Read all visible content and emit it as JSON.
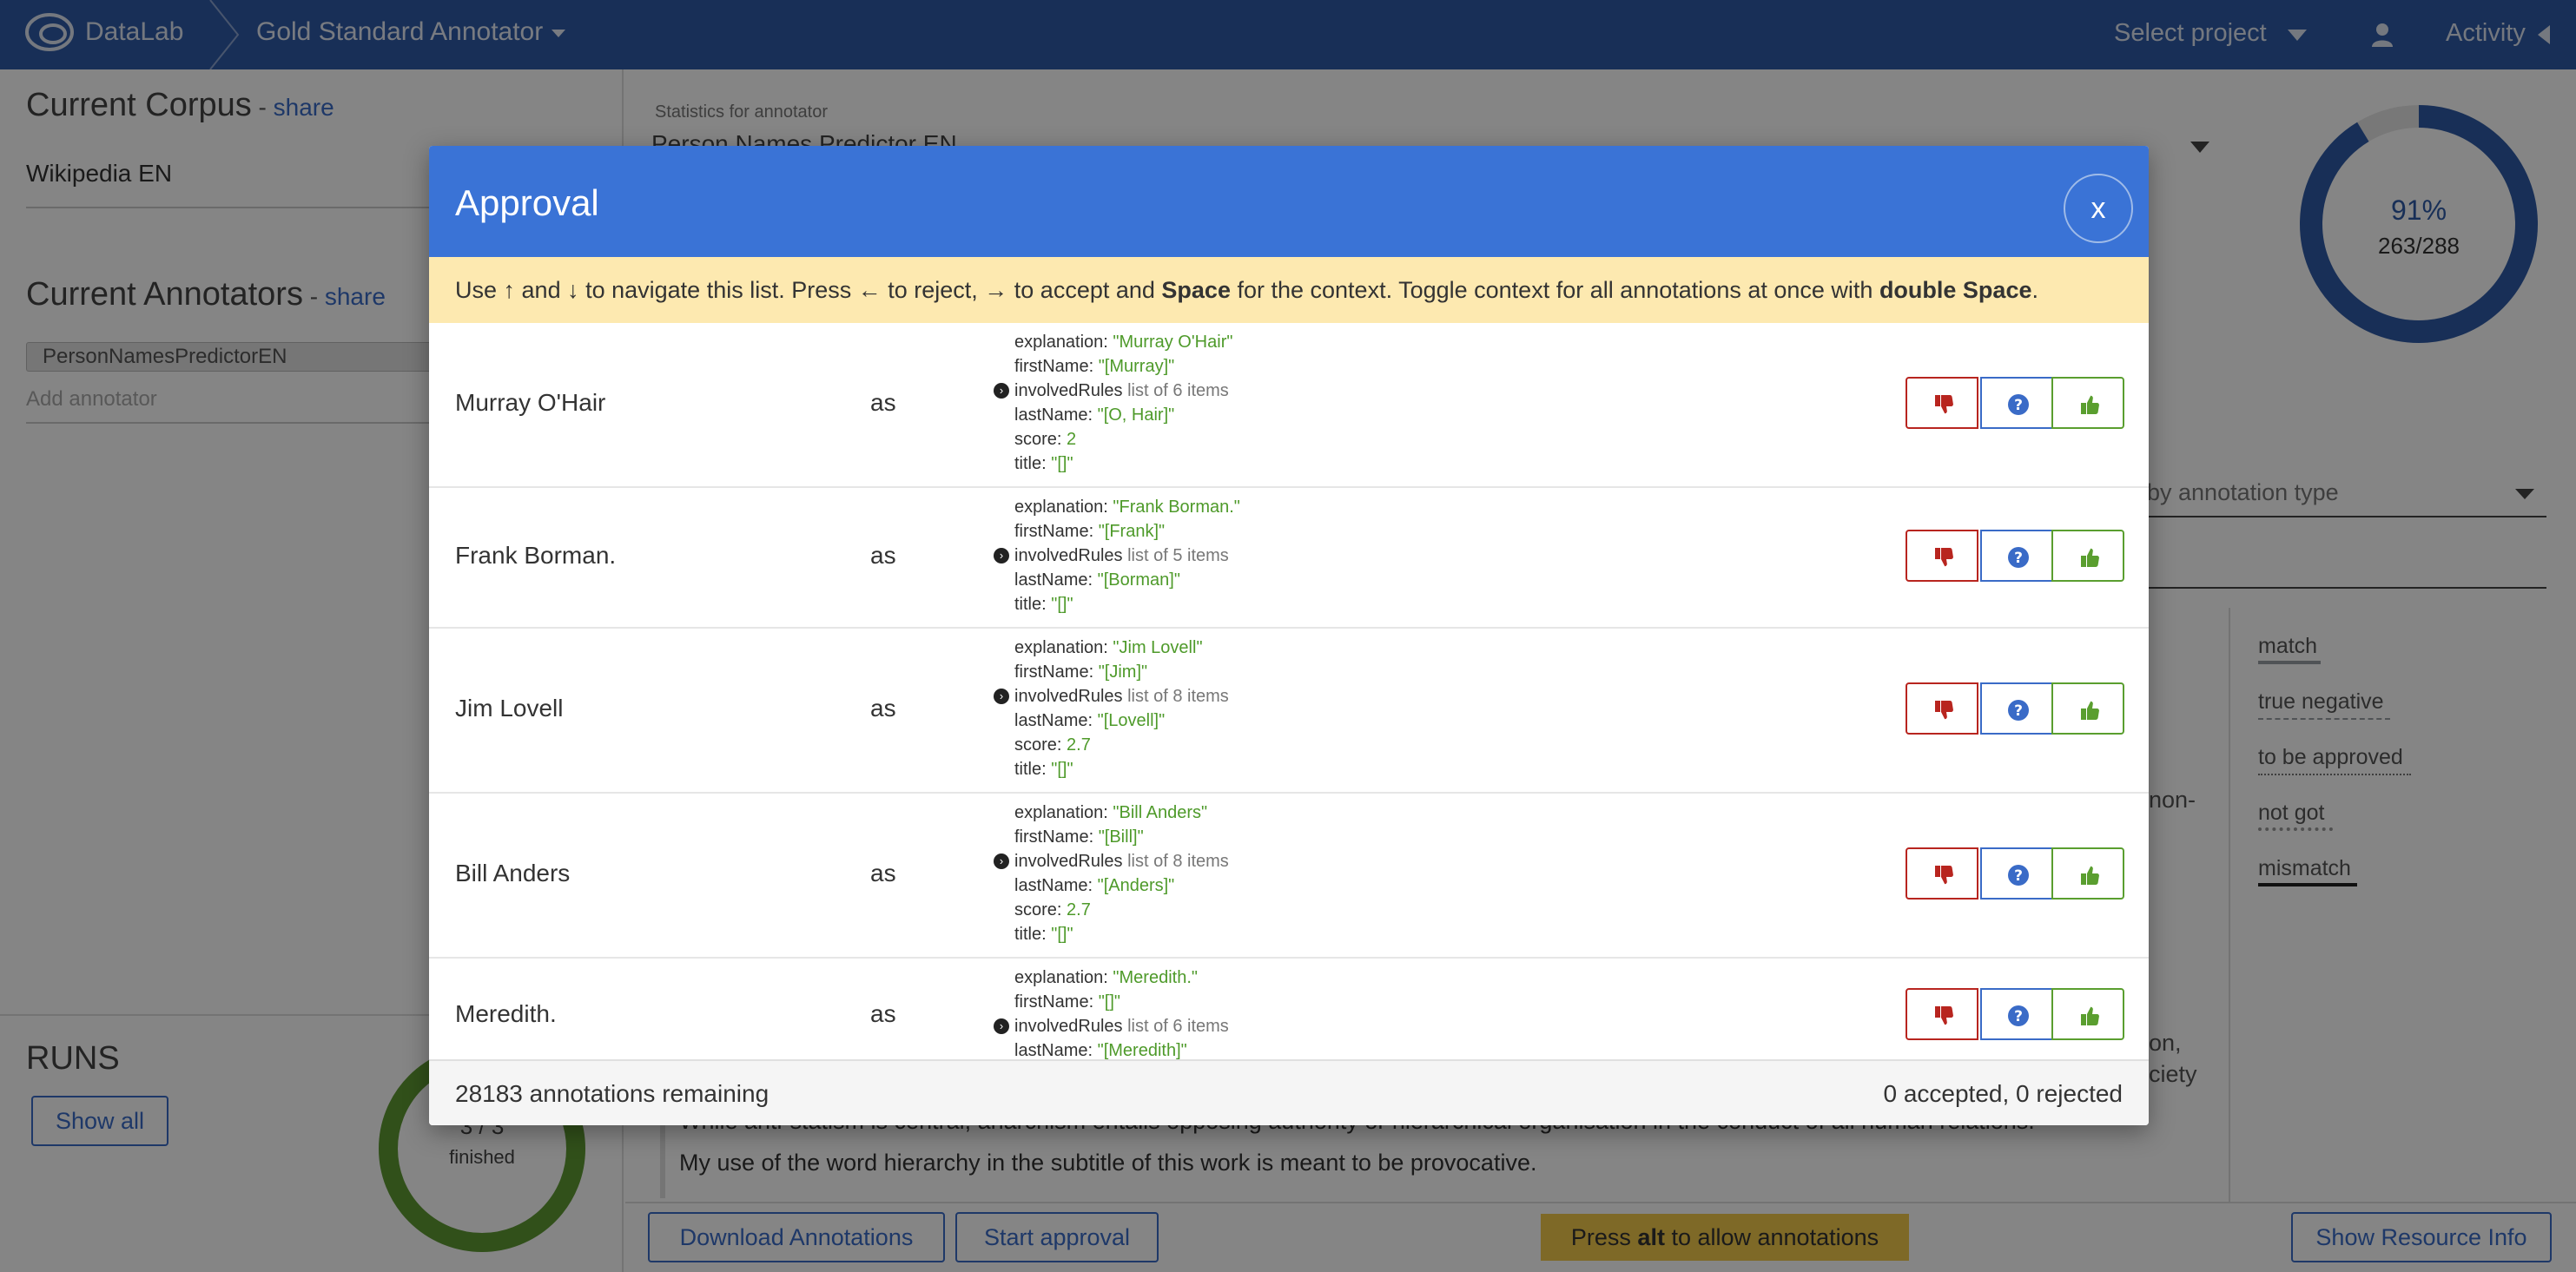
{
  "topbar": {
    "brand": "DataLab",
    "project": "Gold Standard Annotator",
    "select_project": "Select project",
    "activity": "Activity"
  },
  "left": {
    "corpus_title": "Current Corpus",
    "dash": " - ",
    "share": "share",
    "corpus_value": "Wikipedia EN",
    "annotators_title": "Current Annotators",
    "annotator_chip": "PersonNamesPredictorEN",
    "add_annotator": "Add annotator",
    "runs_title": "RUNS",
    "show_all": "Show all",
    "runs_count": "3 / 3",
    "runs_label": "finished",
    "runs_ratio": 1.0
  },
  "main": {
    "stats_label": "Statistics for annotator",
    "stats_select": "Person Names Predictor EN",
    "donut_percent": "91%",
    "donut_fraction": "263/288",
    "donut_ratio": 0.913,
    "type_select": "by annotation type",
    "legend": [
      "match",
      "true negative",
      "to be approved",
      "not got",
      "mismatch"
    ],
    "frag_non": "non-",
    "frag_on": "on,",
    "frag_ciety": "ciety",
    "text_line1": "While anti-statism is central, anarchism entails opposing authority or hierarchical organisation in the conduct of all human relations.",
    "text_line2": "My use of the word hierarchy in the subtitle of this work is meant to be provocative.",
    "download_btn": "Download Annotations",
    "start_btn": "Start approval",
    "alt_hint_pre": "Press",
    "alt_hint_key": "alt",
    "alt_hint_post": "to allow annotations",
    "resource_btn": "Show Resource Info"
  },
  "modal": {
    "title": "Approval",
    "close": "x",
    "hint": {
      "p1": "Use ",
      "up": "↑",
      "p2": " and ",
      "down": "↓",
      "p3": " to navigate this list. Press ",
      "left": "←",
      "p4": " to reject, ",
      "right": "→",
      "p5": " to accept and ",
      "space": "Space",
      "p6": " for the context. Toggle context for all annotations at once with ",
      "dspace": "double Space",
      "p7": "."
    },
    "as": "as",
    "rows": [
      {
        "name": "Murray O'Hair",
        "props": [
          {
            "k": "explanation: ",
            "v": "\"Murray O'Hair\""
          },
          {
            "k": "firstName: ",
            "v": "\"[Murray]\""
          },
          {
            "k": "involvedRules ",
            "v": "list of 6 items",
            "meta": true
          },
          {
            "k": "lastName: ",
            "v": "\"[O, Hair]\""
          },
          {
            "k": "score: ",
            "v": "2"
          },
          {
            "k": "title: ",
            "v": "\"[]\""
          }
        ]
      },
      {
        "name": "Frank Borman.",
        "props": [
          {
            "k": "explanation: ",
            "v": "\"Frank Borman.\""
          },
          {
            "k": "firstName: ",
            "v": "\"[Frank]\""
          },
          {
            "k": "involvedRules ",
            "v": "list of 5 items",
            "meta": true
          },
          {
            "k": "lastName: ",
            "v": "\"[Borman]\""
          },
          {
            "k": "title: ",
            "v": "\"[]\""
          }
        ]
      },
      {
        "name": "Jim Lovell",
        "props": [
          {
            "k": "explanation: ",
            "v": "\"Jim Lovell\""
          },
          {
            "k": "firstName: ",
            "v": "\"[Jim]\""
          },
          {
            "k": "involvedRules ",
            "v": "list of 8 items",
            "meta": true
          },
          {
            "k": "lastName: ",
            "v": "\"[Lovell]\""
          },
          {
            "k": "score: ",
            "v": "2.7"
          },
          {
            "k": "title: ",
            "v": "\"[]\""
          }
        ]
      },
      {
        "name": "Bill Anders",
        "props": [
          {
            "k": "explanation: ",
            "v": "\"Bill Anders\""
          },
          {
            "k": "firstName: ",
            "v": "\"[Bill]\""
          },
          {
            "k": "involvedRules ",
            "v": "list of 8 items",
            "meta": true
          },
          {
            "k": "lastName: ",
            "v": "\"[Anders]\""
          },
          {
            "k": "score: ",
            "v": "2.7"
          },
          {
            "k": "title: ",
            "v": "\"[]\""
          }
        ]
      },
      {
        "name": "Meredith.",
        "props": [
          {
            "k": "explanation: ",
            "v": "\"Meredith.\""
          },
          {
            "k": "firstName: ",
            "v": "\"[]\""
          },
          {
            "k": "involvedRules ",
            "v": "list of 6 items",
            "meta": true
          },
          {
            "k": "lastName: ",
            "v": "\"[Meredith]\""
          }
        ]
      }
    ],
    "remaining": "28183 annotations remaining",
    "tally": "0 accepted, 0 rejected"
  },
  "colors": {
    "topbar": "#2f5ba8",
    "modal_header": "#3a73d6",
    "hint_bg": "#fde9b0",
    "reject": "#b8251f",
    "info": "#3a6bc7",
    "accept": "#5a9e2f",
    "value_green": "#4e9a2a",
    "runs_donut": "#5e9a32"
  },
  "icons": {
    "reject": "thumbs-down-icon",
    "info": "question-circle-icon",
    "accept": "thumbs-up-icon",
    "logo": "datalab-logo",
    "user": "user-icon"
  }
}
